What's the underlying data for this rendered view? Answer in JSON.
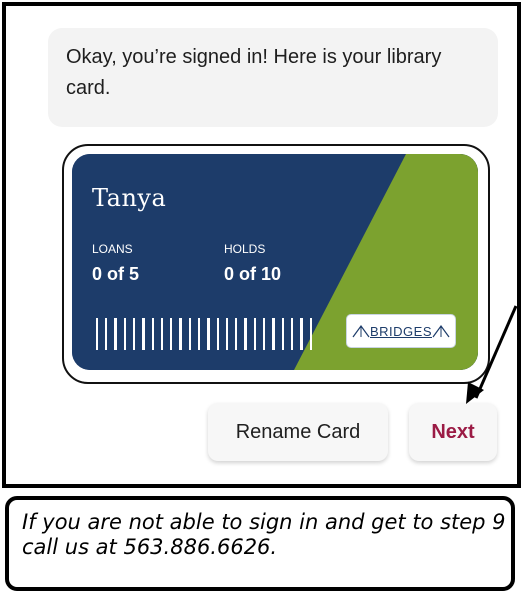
{
  "chat": {
    "message": "Okay, you’re signed in! Here is your library card."
  },
  "card": {
    "name": "Tanya",
    "loans_label": "LOANS",
    "loans_value": "0 of 5",
    "holds_label": "HOLDS",
    "holds_value": "0 of 10",
    "logo_text": "BRIDGES",
    "colors": {
      "navy": "#1d3c6a",
      "green": "#7ca22f"
    }
  },
  "buttons": {
    "rename_label": "Rename Card",
    "next_label": "Next",
    "next_color": "#9b1b45"
  },
  "note": {
    "text": "If you are not able to sign in and get to step 9 call us at 563.886.6626."
  },
  "icons": {
    "barcode": "barcode-icon",
    "logo": "bridge-logo-icon",
    "arrow": "arrow-pointer-icon"
  }
}
